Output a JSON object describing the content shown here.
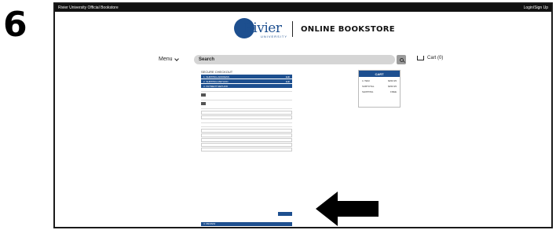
{
  "step_number": "6",
  "topbar": {
    "site_name": "Rivier University Official Bookstore",
    "login": "Login/Sign Up"
  },
  "header": {
    "logo_main": "Rivier",
    "logo_sub": "UNIVERSITY",
    "store_title": "ONLINE BOOKSTORE"
  },
  "nav": {
    "menu_label": "Menu",
    "search_label": "Search",
    "cart_label": "Cart (0)"
  },
  "checkout": {
    "heading": "SECURE CHECKOUT",
    "steps": [
      {
        "label": "1. SHIPPING ADDRESS",
        "action": "Edit"
      },
      {
        "label": "2. SHIPPING METHOD",
        "action": "Edit"
      },
      {
        "label": "3. PAYMENT METHOD",
        "action": ""
      }
    ],
    "review_label": "4. REVIEW"
  },
  "cart_summary": {
    "title": "CART",
    "lines": [
      {
        "label": "1 ITEM",
        "value": "$450.95"
      },
      {
        "label": "SUBTOTAL",
        "value": "$450.95"
      },
      {
        "label": "SHIPPING",
        "value": "FREE"
      }
    ]
  },
  "colors": {
    "brand_blue": "#1d4f8f",
    "topbar": "#111111",
    "search": "#d5d5d5"
  },
  "icons": [
    "search-icon",
    "cart-icon",
    "chevron-down-icon",
    "arrow-icon"
  ]
}
